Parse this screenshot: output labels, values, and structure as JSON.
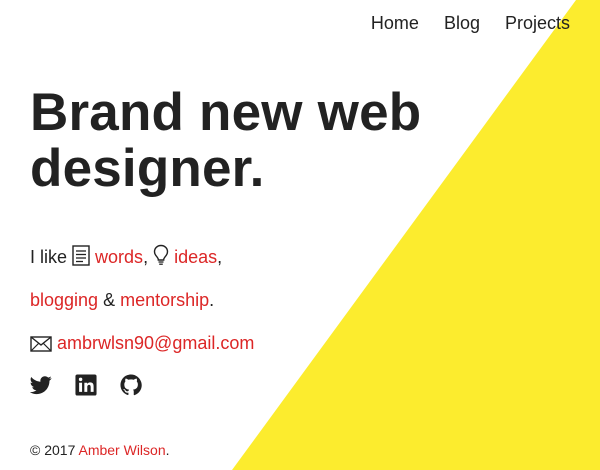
{
  "colors": {
    "accent": "#dc2626",
    "background_shape": "#fcec2e",
    "text": "#222222"
  },
  "nav": {
    "items": [
      {
        "label": "Home"
      },
      {
        "label": "Blog"
      },
      {
        "label": "Projects"
      }
    ]
  },
  "hero": {
    "headline_line1": "Brand new web",
    "headline_line2": "designer."
  },
  "intro": {
    "i_like": "I like",
    "words": "words",
    "comma1": ",",
    "ideas": "ideas",
    "comma2": ",",
    "blogging": "blogging",
    "amp": "&",
    "mentorship": "mentorship",
    "period": ".",
    "email": "ambrwlsn90@gmail.com"
  },
  "social": {
    "icons": [
      "twitter-icon",
      "linkedin-icon",
      "github-icon"
    ]
  },
  "footer": {
    "copyright": "© 2017",
    "author": "Amber Wilson",
    "period": "."
  }
}
